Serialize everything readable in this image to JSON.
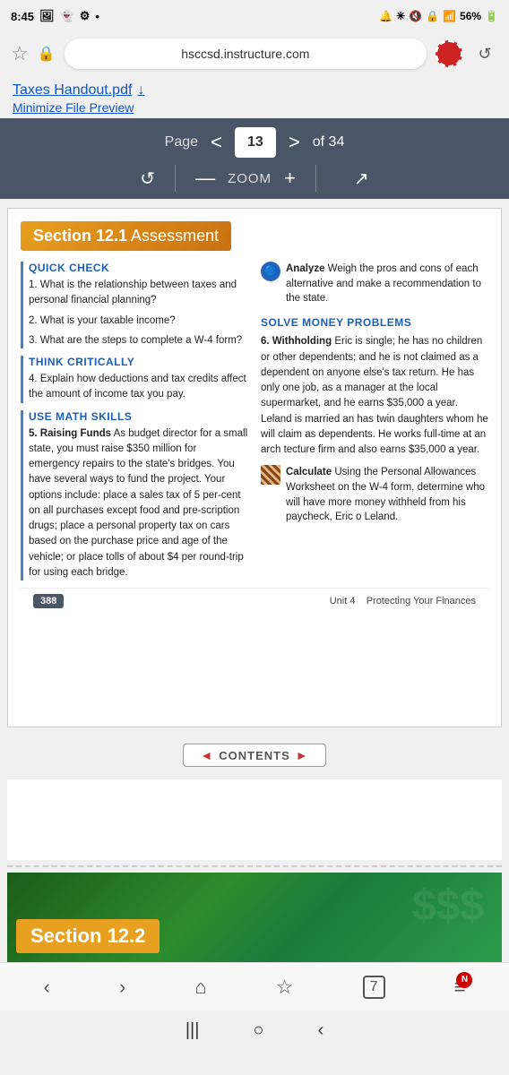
{
  "statusBar": {
    "time": "8:45",
    "battery": "56%"
  },
  "browserBar": {
    "url": "hsccsd.instructure.com"
  },
  "fileHeader": {
    "title": "Taxes Handout.pdf",
    "minimize": "Minimize File Preview",
    "downloadIcon": "↓"
  },
  "pdfToolbar": {
    "pageLabel": "Page",
    "prevIcon": "<",
    "nextIcon": ">",
    "currentPage": "13",
    "totalPages": "of 34",
    "zoom": "ZOOM",
    "zoomMinus": "—",
    "zoomPlus": "+",
    "expandIcon": "↗",
    "rotateIcon": "↺"
  },
  "pdfContent": {
    "sectionTitle": "Section 12.1",
    "sectionTitleNormal": " Assessment",
    "quickCheck": {
      "title": "QUICK CHECK",
      "questions": [
        "1. What is the relationship between taxes and personal financial planning?",
        "2. What is your taxable income?",
        "3. What are the steps to complete a W-4 form?"
      ]
    },
    "thinkCritically": {
      "title": "THINK CRITICALLY",
      "questions": [
        "4. Explain how deductions and tax credits affect the amount of income tax you pay."
      ]
    },
    "useMathSkills": {
      "title": "USE MATH SKILLS",
      "q5title": "5. Raising Funds",
      "q5text": "As budget director for a small state, you must raise $350 million for emergency repairs to the state's bridges. You have several ways to fund the project. Your options include: place a sales tax of 5 per-cent on all purchases except food and pre-scription drugs; place a personal property tax on cars based on the purchase price and age of the vehicle; or place tolls of about $4 per round-trip for using each bridge."
    },
    "rightCol": {
      "analyzeText": "Analyze  Weigh the pros and cons of each alternative and make a recommendation to the state.",
      "analyzeBold": "Analyze",
      "solveTitle": "SOLVE MONEY PROBLEMS",
      "q6title": "6. Withholding",
      "q6text": "Eric is single; he has no children or other dependents; and he is not claimed as a dependent on anyone else's tax return. He has only one job, as a manager at the local supermarket, and he earns $35,000 a year. Leland is married an has twin daughters whom he will claim as dependents. He works full-time at an arch tecture firm and also earns $35,000 a year.",
      "calcTitle": "Calculate",
      "calcText": "Using the Personal Allowances Worksheet on the W-4 form, determine who will have more money withheld from his paycheck, Eric o Leland."
    }
  },
  "footer": {
    "pageNum": "388",
    "unitText": "Unit 4",
    "unitDesc": "Protecting Your Finances",
    "contents": "CONTENTS"
  },
  "nextSection": {
    "label": "Section 12.2"
  },
  "bottomNav": {
    "back": "‹",
    "forward": "›",
    "home": "⌂",
    "bookmark": "☆",
    "tabs": "7",
    "menu": "≡",
    "notif": "N"
  },
  "homeIndicator": {
    "menu": "|||",
    "circle": "○",
    "back": "‹"
  }
}
